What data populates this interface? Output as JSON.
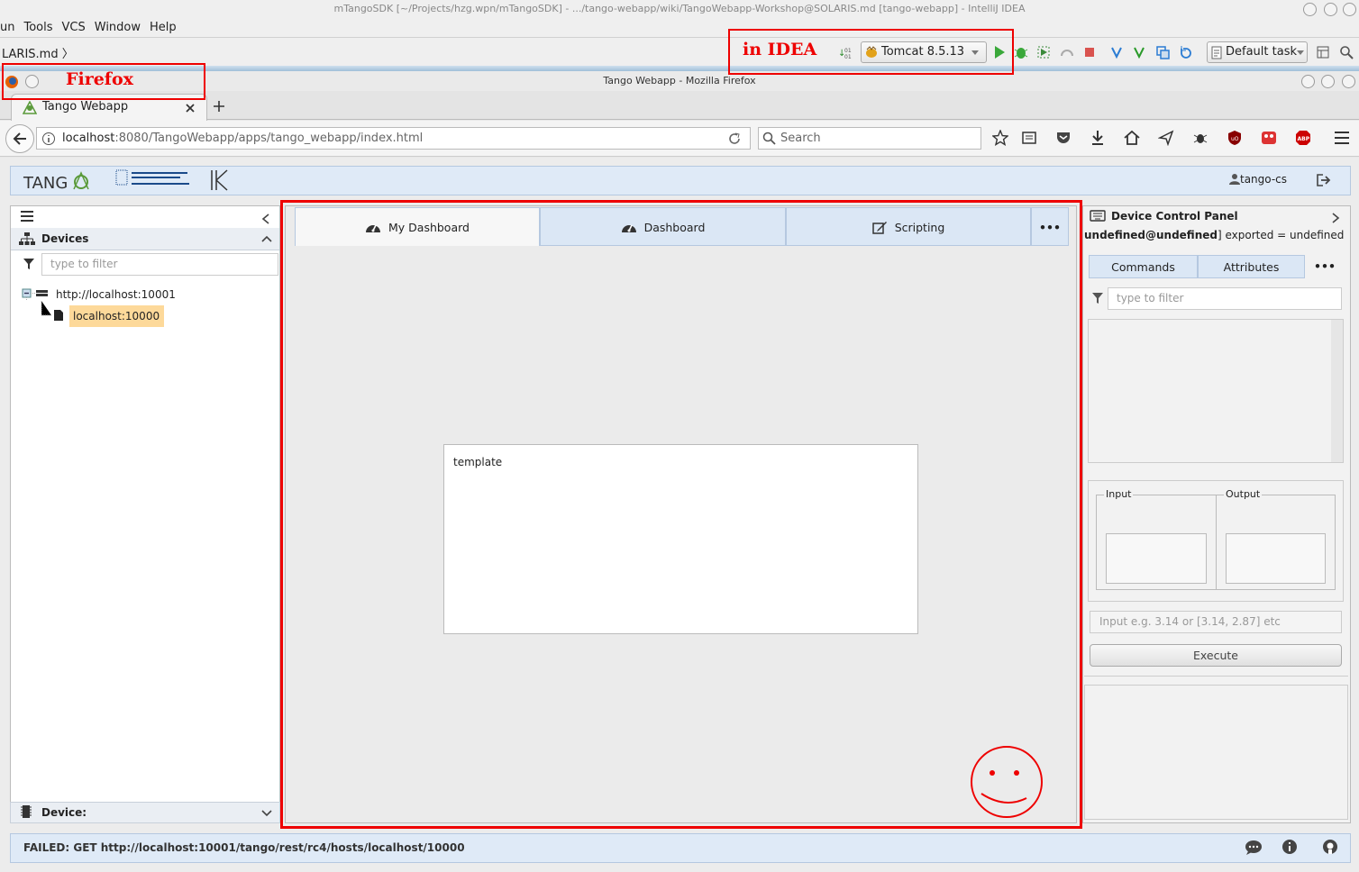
{
  "idea": {
    "title": "mTangoSDK [~/Projects/hzg.wpn/mTangoSDK] - .../tango-webapp/wiki/TangoWebapp-Workshop@SOLARIS.md [tango-webapp] - IntelliJ IDEA",
    "menu": [
      "un",
      "Tools",
      "VCS",
      "Window",
      "Help"
    ],
    "breadcrumb": "LARIS.md",
    "run_config": "Tomcat 8.5.13",
    "task": "Default task"
  },
  "firefox": {
    "title": "Tango Webapp - Mozilla Firefox",
    "tab_label": "Tango Webapp",
    "url_host": "localhost",
    "url_rest": ":8080/TangoWebapp/apps/tango_webapp/index.html",
    "search_placeholder": "Search"
  },
  "annotations": {
    "firefox_label": "Firefox",
    "idea_label": "in IDEA"
  },
  "app": {
    "user": "tango-cs",
    "devices_title": "Devices",
    "filter_placeholder": "type to filter",
    "tree_root": "http://localhost:10001",
    "tree_child": "localhost:10000",
    "device_footer": "Device:",
    "tabs": [
      {
        "label": "My Dashboard"
      },
      {
        "label": "Dashboard"
      },
      {
        "label": "Scripting"
      }
    ],
    "more": "•••",
    "template_text": "template",
    "status": "FAILED: GET http://localhost:10001/tango/rest/rc4/hosts/localhost/10000"
  },
  "dcp": {
    "title": "Device Control Panel",
    "device_name": "undefined@undefined",
    "exported": "] exported = undefined",
    "tabs": [
      "Commands",
      "Attributes"
    ],
    "filter_placeholder": "type to filter",
    "input_label": "Input",
    "output_label": "Output",
    "input_placeholder": "Input e.g. 3.14 or [3.14, 2.87] etc",
    "execute": "Execute"
  },
  "colors": {
    "annotation_red": "#e00000",
    "panel_blue": "#dfeaf7",
    "selected_orange": "#fdd99a"
  }
}
